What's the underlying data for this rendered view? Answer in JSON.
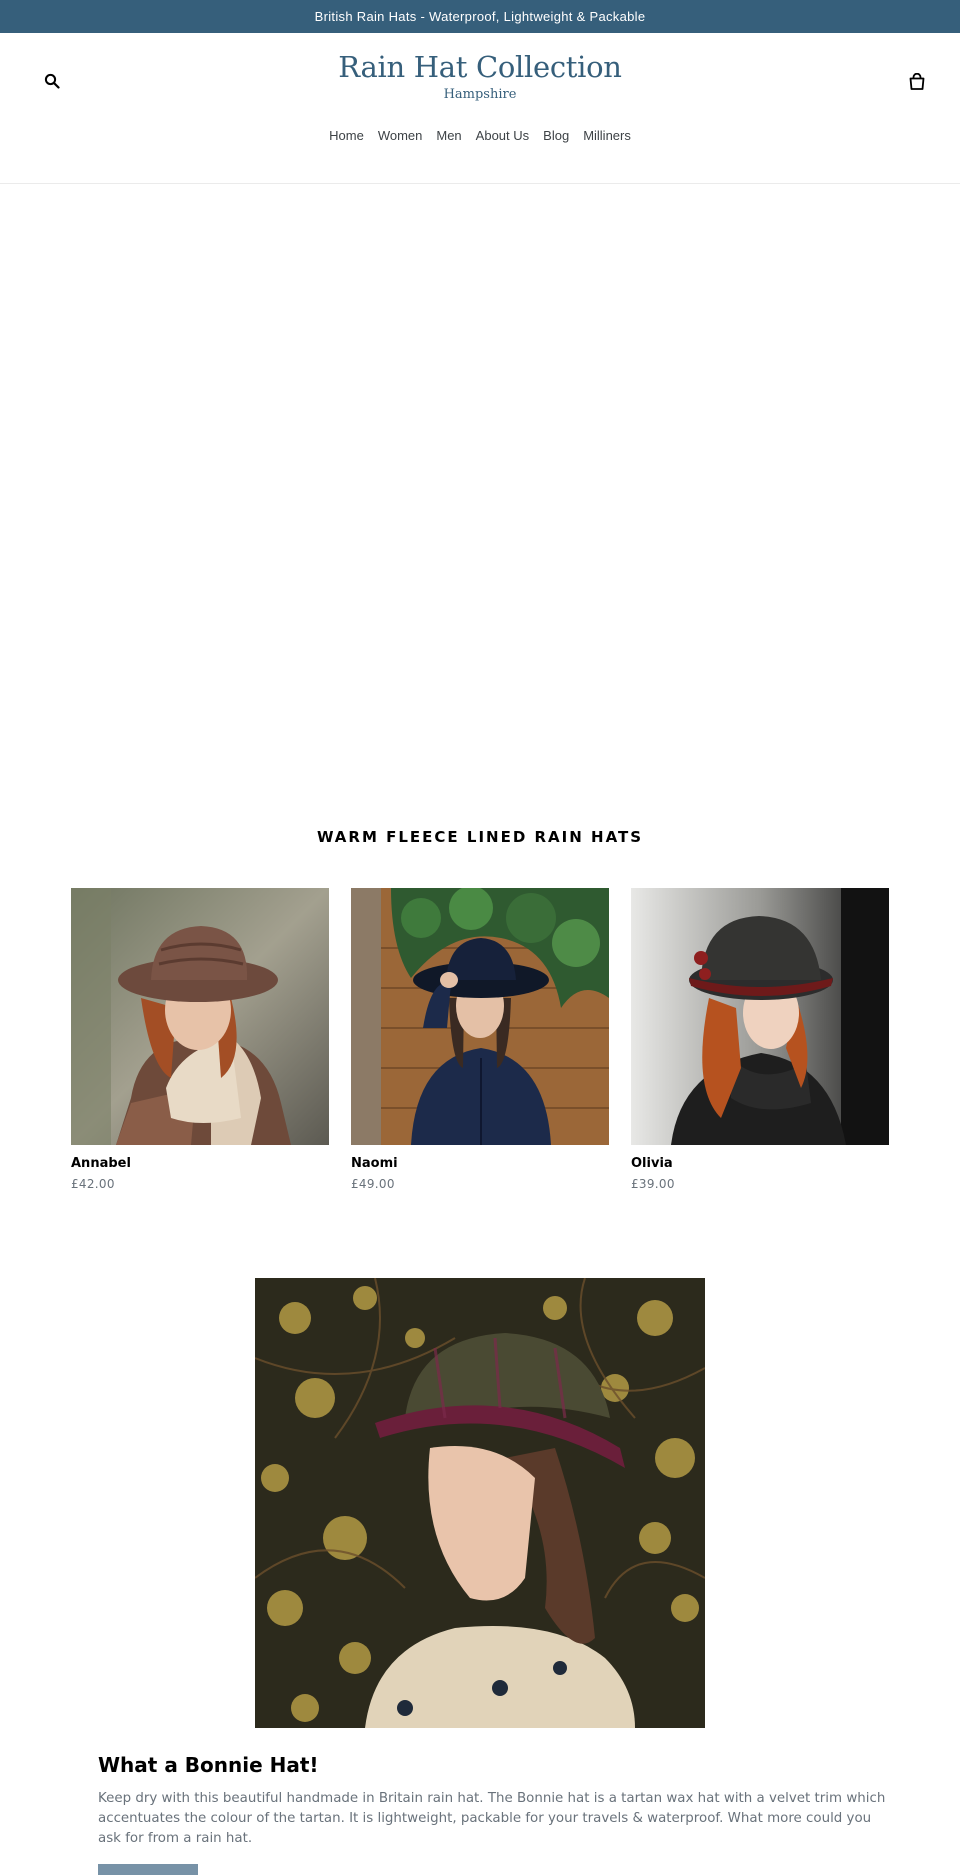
{
  "announcement": {
    "text": "British Rain Hats - Waterproof, Lightweight & Packable"
  },
  "header": {
    "logo_title": "Rain Hat Collection",
    "logo_subtitle": "Hampshire",
    "search_icon": "search-icon",
    "cart_icon": "cart-icon",
    "nav": [
      {
        "label": "Home"
      },
      {
        "label": "Women"
      },
      {
        "label": "Men"
      },
      {
        "label": "About Us"
      },
      {
        "label": "Blog"
      },
      {
        "label": "Milliners"
      }
    ]
  },
  "collection": {
    "title": "WARM FLEECE LINED RAIN HATS",
    "products": [
      {
        "name": "Annabel",
        "price": "£42.00"
      },
      {
        "name": "Naomi",
        "price": "£49.00"
      },
      {
        "name": "Olivia",
        "price": "£39.00"
      }
    ]
  },
  "feature": {
    "heading": "What a Bonnie Hat!",
    "text": "Keep dry with this beautiful handmade in Britain rain hat.  The Bonnie hat is a tartan wax hat with a velvet trim which accentuates the colour of the tartan.  It is lightweight, packable for your travels & waterproof.  What more could you ask for from a rain hat."
  },
  "colors": {
    "brand": "#365f7b",
    "button": "#7792a7",
    "price": "#69727b"
  }
}
